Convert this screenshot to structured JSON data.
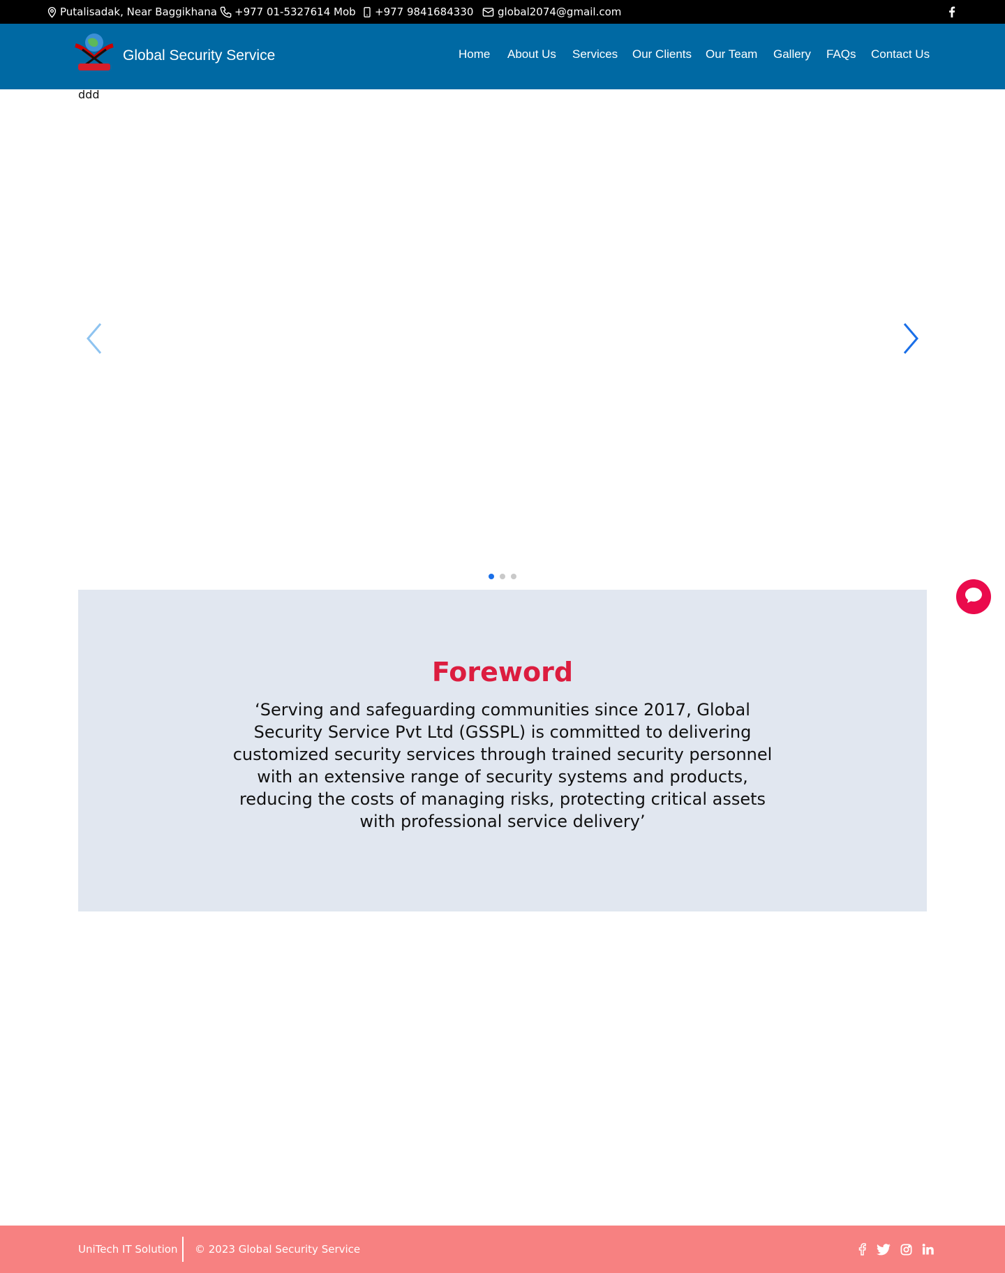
{
  "topbar": {
    "address": "Putalisadak, Near Baggikhana",
    "phone": "+977 01-5327614 Mob",
    "mobile": "+977 9841684330",
    "email": "global2074@gmail.com",
    "social_icon": "facebook-icon"
  },
  "header": {
    "brand": "Global Security Service",
    "logo_text": "Global Security",
    "nav": [
      "Home",
      "About Us",
      "Services",
      "Our Clients",
      "Our Team",
      "Gallery",
      "FAQs",
      "Contact Us"
    ]
  },
  "carousel": {
    "image_alt": "ddd",
    "slide_count": 3,
    "active_slide": 1
  },
  "foreword": {
    "title": "Foreword",
    "text": "‘Serving and safeguarding communities since 2017, Global Security Service Pvt Ltd (GSSPL) is committed to delivering customized security services through trained security personnel with an extensive range of security systems and products, reducing the costs of managing risks, protecting critical assets with professional service delivery’"
  },
  "footer": {
    "company": "UniTech IT Solution",
    "copyright": "© 2023 Global Security Service",
    "social_icons": [
      "facebook-icon",
      "twitter-icon",
      "instagram-icon",
      "linkedin-icon"
    ]
  },
  "colors": {
    "topbar_bg": "#000000",
    "header_bg": "#0069a3",
    "foreword_bg": "#e1e7f0",
    "foreword_title": "#dc1d3f",
    "chat_button": "#ea0b4c",
    "footer_bg": "#f78181",
    "dot_active": "#1a6fe8"
  }
}
